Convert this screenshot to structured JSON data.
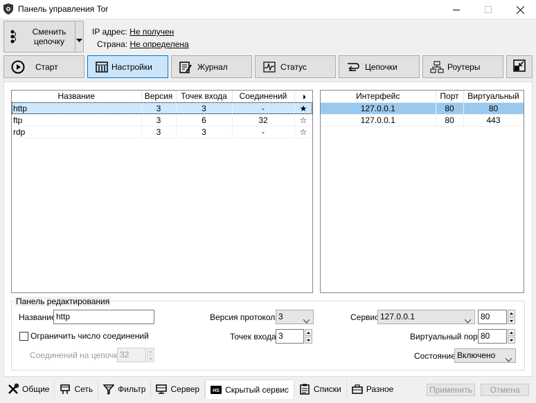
{
  "window": {
    "title": "Панель управления Tor"
  },
  "top": {
    "change_chain_label": "Сменить\nцепочку",
    "ip_label": "IP адрес:",
    "ip_value": "Не получен",
    "country_label": "Страна:",
    "country_value": "Не определена"
  },
  "toolbar": {
    "start": "Старт",
    "settings": "Настройки",
    "log": "Журнал",
    "status": "Статус",
    "chains": "Цепочки",
    "routers": "Роутеры"
  },
  "services_table": {
    "headers": [
      "Название",
      "Версия",
      "Точек входа",
      "Соединений",
      "◑"
    ],
    "rows": [
      [
        "http",
        "3",
        "3",
        "-",
        "★"
      ],
      [
        "ftp",
        "3",
        "6",
        "32",
        "☆"
      ],
      [
        "rdp",
        "3",
        "3",
        "-",
        "☆"
      ]
    ]
  },
  "ports_table": {
    "headers": [
      "Интерфейс",
      "Порт",
      "Виртуальный"
    ],
    "rows": [
      [
        "127.0.0.1",
        "80",
        "80"
      ],
      [
        "127.0.0.1",
        "80",
        "443"
      ]
    ]
  },
  "edit_panel": {
    "title": "Панель редактирования",
    "name_label": "Название",
    "name_value": "http",
    "limit_label": "Ограничить число соединений",
    "conn_per_chain_label": "Соединений на цепочку",
    "conn_per_chain_value": "32",
    "protocol_label": "Версия протокола",
    "protocol_value": "3",
    "entry_points_label": "Точек входа",
    "entry_points_value": "3",
    "service_label": "Сервис",
    "service_value": "127.0.0.1",
    "service_port_value": "80",
    "virtual_port_label": "Виртуальный порт",
    "virtual_port_value": "80",
    "state_label": "Состояние",
    "state_value": "Включено"
  },
  "tabs": [
    "Общие",
    "Сеть",
    "Фильтр",
    "Сервер",
    "Скрытый сервис",
    "Списки",
    "Разное"
  ],
  "actions": {
    "apply": "Применить",
    "cancel": "Отмена"
  },
  "colors": {
    "selection": "#99c9ef",
    "active_button": "#cce4f7",
    "accent": "#0078d7"
  }
}
